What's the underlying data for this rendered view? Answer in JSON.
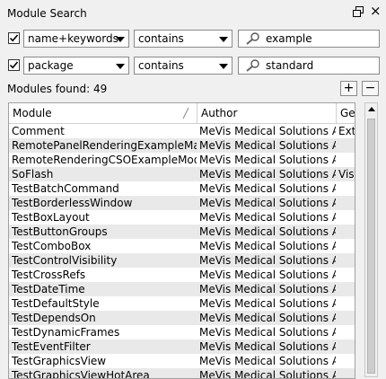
{
  "window": {
    "title": "Module Search"
  },
  "filters": [
    {
      "checked": true,
      "field": "name+keywords",
      "operator": "contains",
      "value": "example"
    },
    {
      "checked": true,
      "field": "package",
      "operator": "contains",
      "value": "standard"
    }
  ],
  "results": {
    "count_label": "Modules found: 49",
    "add_label": "+",
    "remove_label": "−"
  },
  "table": {
    "columns": [
      "Module",
      "Author",
      "Genre"
    ],
    "rows": [
      [
        "Comment",
        "MeVis Medical Solutions AG",
        "Extras"
      ],
      [
        "RemotePanelRenderingExampleMacro",
        "MeVis Medical Solutions AG",
        ""
      ],
      [
        "RemoteRenderingCSOExampleModule",
        "MeVis Medical Solutions AG",
        ""
      ],
      [
        "SoFlash",
        "MeVis Medical Solutions AG",
        "Visual"
      ],
      [
        "TestBatchCommand",
        "MeVis Medical Solutions AG",
        ""
      ],
      [
        "TestBorderlessWindow",
        "MeVis Medical Solutions AG",
        ""
      ],
      [
        "TestBoxLayout",
        "MeVis Medical Solutions AG",
        ""
      ],
      [
        "TestButtonGroups",
        "MeVis Medical Solutions AG",
        ""
      ],
      [
        "TestComboBox",
        "MeVis Medical Solutions AG",
        ""
      ],
      [
        "TestControlVisibility",
        "MeVis Medical Solutions AG",
        ""
      ],
      [
        "TestCrossRefs",
        "MeVis Medical Solutions AG",
        ""
      ],
      [
        "TestDateTime",
        "MeVis Medical Solutions AG",
        ""
      ],
      [
        "TestDefaultStyle",
        "MeVis Medical Solutions AG",
        ""
      ],
      [
        "TestDependsOn",
        "MeVis Medical Solutions AG",
        ""
      ],
      [
        "TestDynamicFrames",
        "MeVis Medical Solutions AG",
        ""
      ],
      [
        "TestEventFilter",
        "MeVis Medical Solutions AG",
        ""
      ],
      [
        "TestGraphicsView",
        "MeVis Medical Solutions AG",
        ""
      ],
      [
        "TestGraphicsViewHotArea",
        "MeVis Medical Solutions AG",
        ""
      ]
    ]
  }
}
